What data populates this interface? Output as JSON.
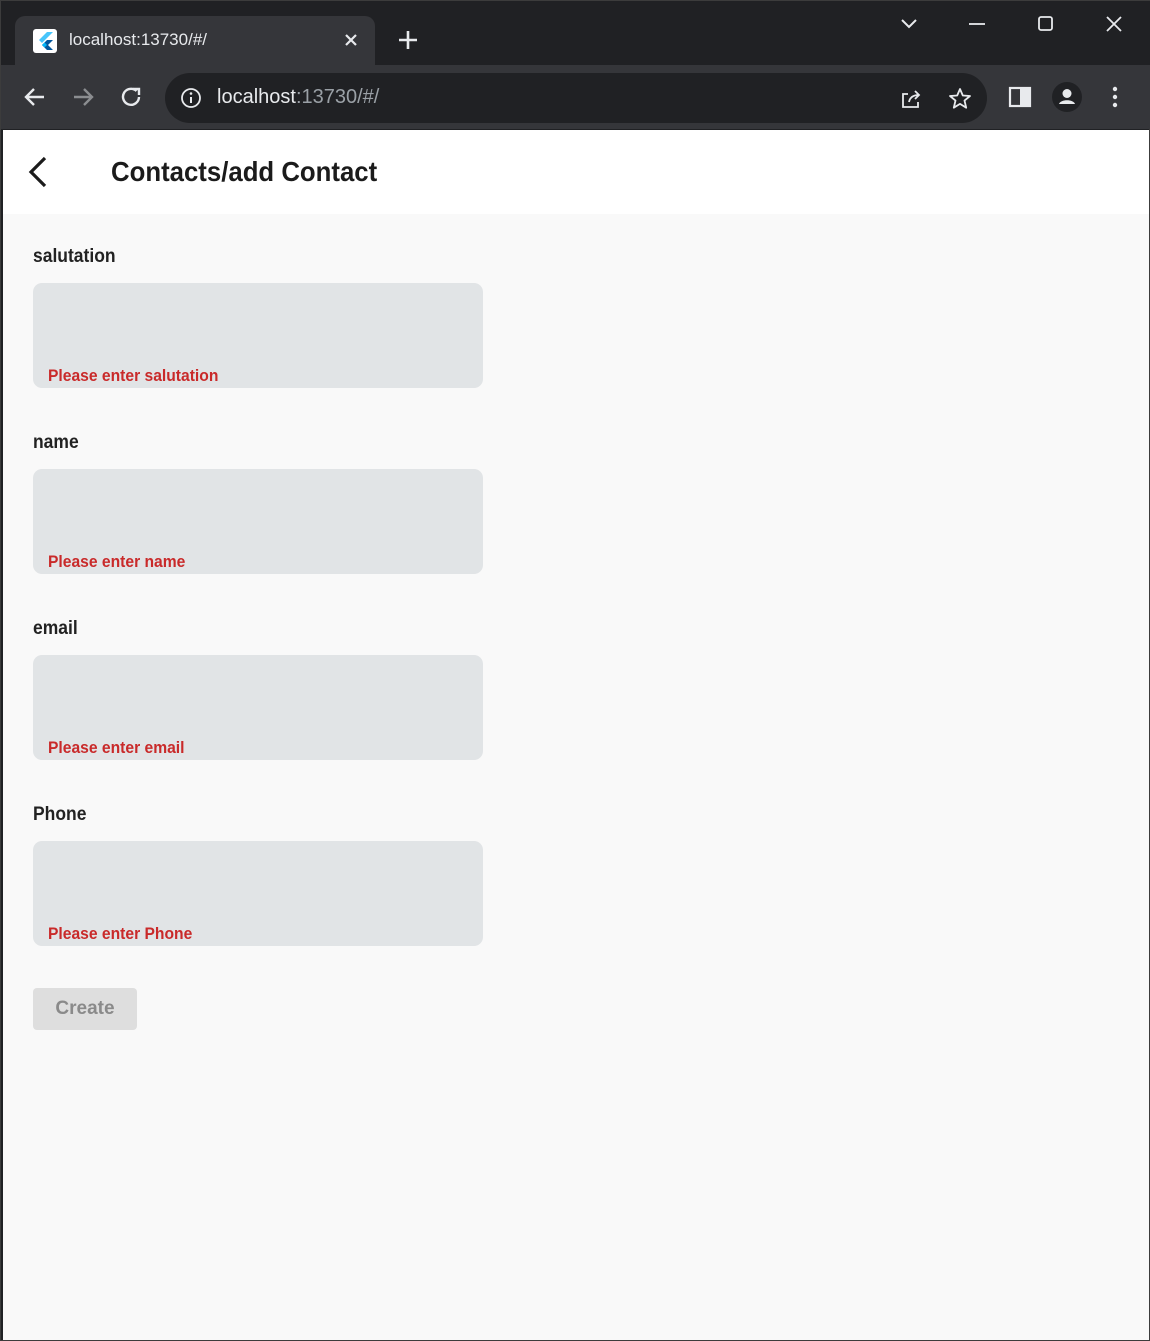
{
  "browser": {
    "tab_title": "localhost:13730/#/",
    "tab_close_icon": "close-icon",
    "url_host": "localhost",
    "url_rest": ":13730/#/"
  },
  "app": {
    "title": "Contacts/add Contact",
    "fields": [
      {
        "label": "salutation",
        "error": "Please enter salutation"
      },
      {
        "label": "name",
        "error": "Please enter name"
      },
      {
        "label": "email",
        "error": "Please enter email"
      },
      {
        "label": "Phone",
        "error": "Please enter Phone"
      }
    ],
    "create_label": "Create"
  },
  "colors": {
    "error": "#c92a2a",
    "field_fill": "#e1e4e6",
    "app_bg": "#f9f9f9"
  }
}
